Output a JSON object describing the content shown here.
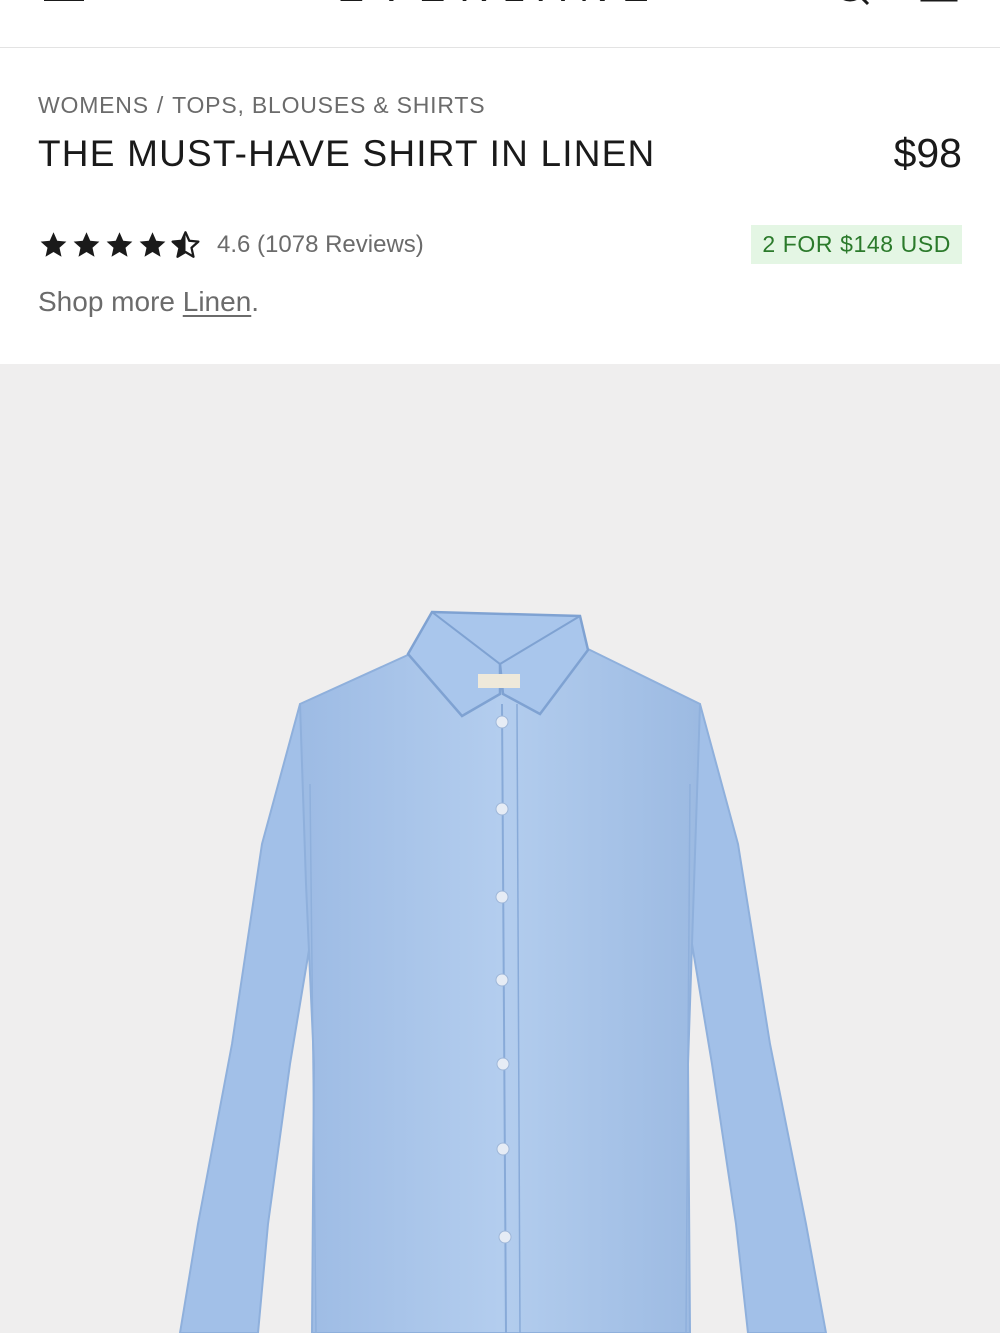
{
  "header": {
    "logo": "EVERLANE",
    "menu_icon": "hamburger-menu-icon",
    "search_icon": "search-icon",
    "cart_icon": "cart-icon"
  },
  "breadcrumb": {
    "items": [
      "WOMENS",
      "TOPS, BLOUSES & SHIRTS"
    ],
    "separator": "/"
  },
  "product": {
    "title": "THE MUST-HAVE SHIRT IN LINEN",
    "price": "$98",
    "rating_value": 4.6,
    "rating_max": 5,
    "rating_text": "4.6 (1078 Reviews)",
    "promo": "2 FOR $148 USD",
    "shop_more_prefix": "Shop more ",
    "shop_more_link": "Linen",
    "shop_more_suffix": "."
  },
  "colors": {
    "promo_bg": "#e4f6e4",
    "promo_text": "#2b7a2b",
    "shirt": "#a9c6ec",
    "image_bg": "#efeeee"
  }
}
